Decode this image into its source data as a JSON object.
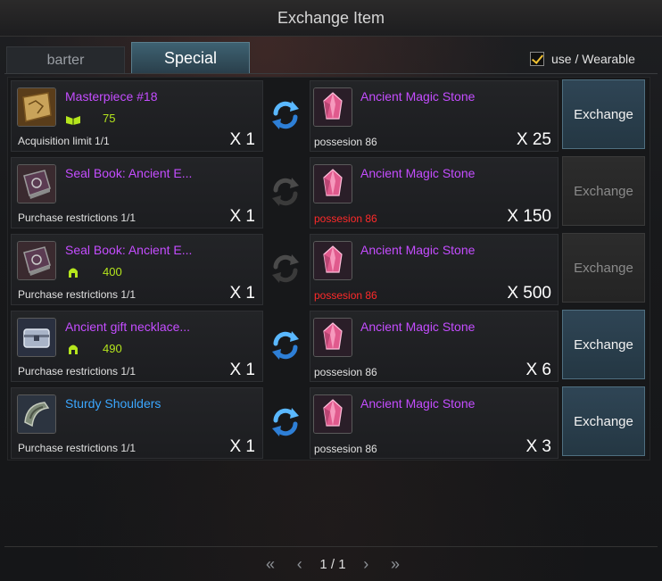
{
  "window": {
    "title": "Exchange Item"
  },
  "tabs": [
    {
      "label": "barter",
      "active": false
    },
    {
      "label": "Special",
      "active": true
    }
  ],
  "options": {
    "use_wearable_label": "use / Wearable",
    "use_wearable_checked": true
  },
  "rows": [
    {
      "item_name": "Masterpiece #18",
      "item_color": "purple",
      "item_icon": "treasure-map-icon",
      "stat_icon": "book-stat-icon",
      "stat_value": "75",
      "limit": "Acquisition limit 1/1",
      "qty": "X 1",
      "cost_name": "Ancient Magic Stone",
      "cost_icon": "magic-stone-icon",
      "possession": "possesion 86",
      "possession_insufficient": false,
      "cost_qty": "X 25",
      "swap_active": true,
      "button": "Exchange",
      "enabled": true
    },
    {
      "item_name": "Seal Book: Ancient E...",
      "item_color": "purple",
      "item_icon": "seal-book-icon",
      "stat_icon": "",
      "stat_value": "",
      "limit": "Purchase restrictions 1/1",
      "qty": "X 1",
      "cost_name": "Ancient Magic Stone",
      "cost_icon": "magic-stone-icon",
      "possession": "possesion 86",
      "possession_insufficient": true,
      "cost_qty": "X 150",
      "swap_active": false,
      "button": "Exchange",
      "enabled": false
    },
    {
      "item_name": "Seal Book: Ancient E...",
      "item_color": "purple",
      "item_icon": "seal-book-icon",
      "stat_icon": "helmet-stat-icon",
      "stat_value": "400",
      "limit": "Purchase restrictions 1/1",
      "qty": "X 1",
      "cost_name": "Ancient Magic Stone",
      "cost_icon": "magic-stone-icon",
      "possession": "possesion 86",
      "possession_insufficient": true,
      "cost_qty": "X 500",
      "swap_active": false,
      "button": "Exchange",
      "enabled": false
    },
    {
      "item_name": "Ancient gift necklace...",
      "item_color": "purple",
      "item_icon": "silver-chest-icon",
      "stat_icon": "helmet-stat-icon",
      "stat_value": "490",
      "limit": "Purchase restrictions 1/1",
      "qty": "X 1",
      "cost_name": "Ancient Magic Stone",
      "cost_icon": "magic-stone-icon",
      "possession": "possesion 86",
      "possession_insufficient": false,
      "cost_qty": "X 6",
      "swap_active": true,
      "button": "Exchange",
      "enabled": true
    },
    {
      "item_name": "Sturdy Shoulders",
      "item_color": "blue",
      "item_icon": "shoulder-armor-icon",
      "stat_icon": "",
      "stat_value": "",
      "limit": "Purchase restrictions 1/1",
      "qty": "X 1",
      "cost_name": "Ancient Magic Stone",
      "cost_icon": "magic-stone-icon",
      "possession": "possesion 86",
      "possession_insufficient": false,
      "cost_qty": "X 3",
      "swap_active": true,
      "button": "Exchange",
      "enabled": true
    }
  ],
  "pagination": {
    "text": "1 / 1"
  },
  "colors": {
    "epic_purple": "#c44dff",
    "rare_blue": "#3ba7ff",
    "insufficient_red": "#ff2a2a",
    "stat_green": "#b5e61d",
    "checkbox_gold": "#f1c232"
  }
}
